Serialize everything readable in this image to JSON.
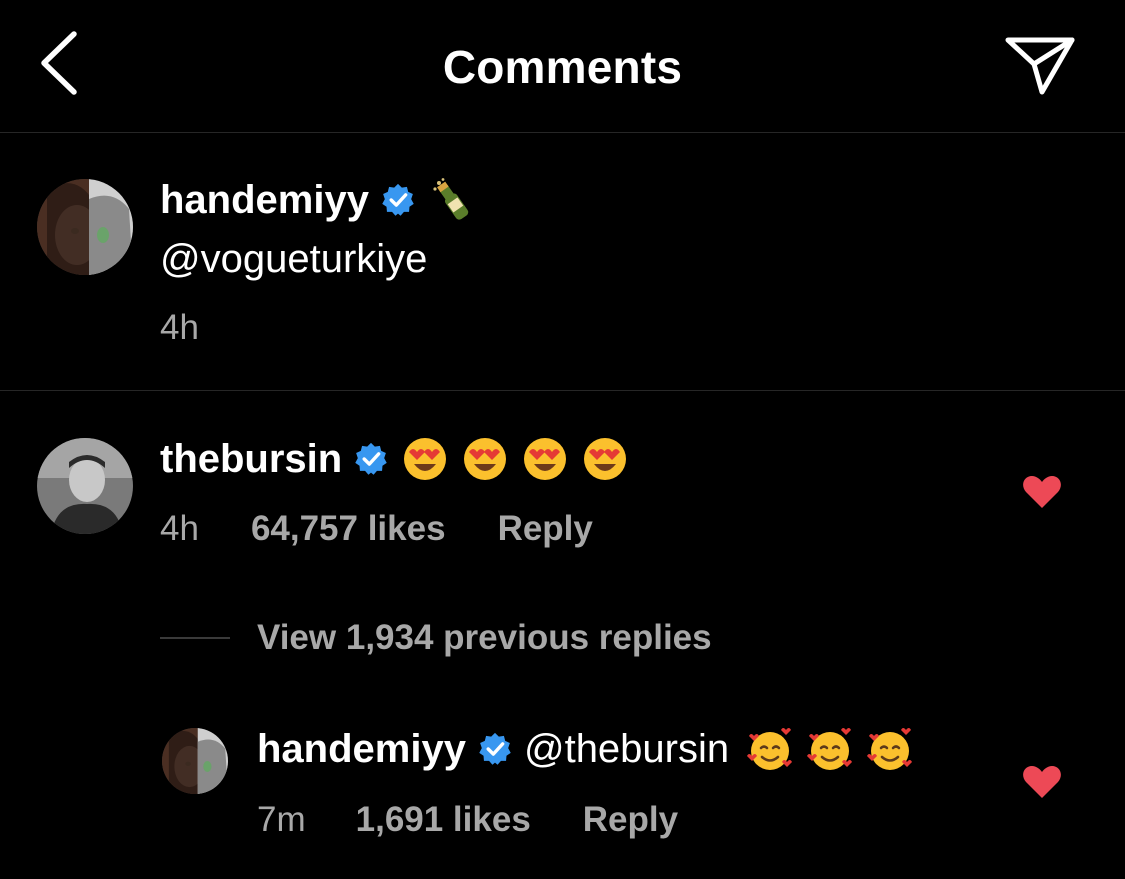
{
  "header": {
    "title": "Comments",
    "back_icon": "chevron-left-icon",
    "share_icon": "paper-plane-icon"
  },
  "caption": {
    "username": "handemiyy",
    "emoji": "bottle-with-popping-cork",
    "text": "@vogueturkiye",
    "time": "4h"
  },
  "comment": {
    "username": "thebursin",
    "emojis": [
      "heart-eyes",
      "heart-eyes",
      "heart-eyes",
      "heart-eyes"
    ],
    "time": "4h",
    "likes": "64,757 likes",
    "reply": "Reply",
    "liked": true,
    "view_replies": "View 1,934 previous replies"
  },
  "reply": {
    "username": "handemiyy",
    "text": "@thebursin",
    "emojis": [
      "smiling-face-with-hearts",
      "smiling-face-with-hearts",
      "smiling-face-with-hearts"
    ],
    "time": "7m",
    "likes": "1,691 likes",
    "reply": "Reply",
    "liked": true
  },
  "colors": {
    "background": "#000000",
    "text": "#ffffff",
    "secondary": "#a8a8a8",
    "verified": "#3897f0",
    "heart": "#ed4956",
    "divider": "#262626"
  }
}
